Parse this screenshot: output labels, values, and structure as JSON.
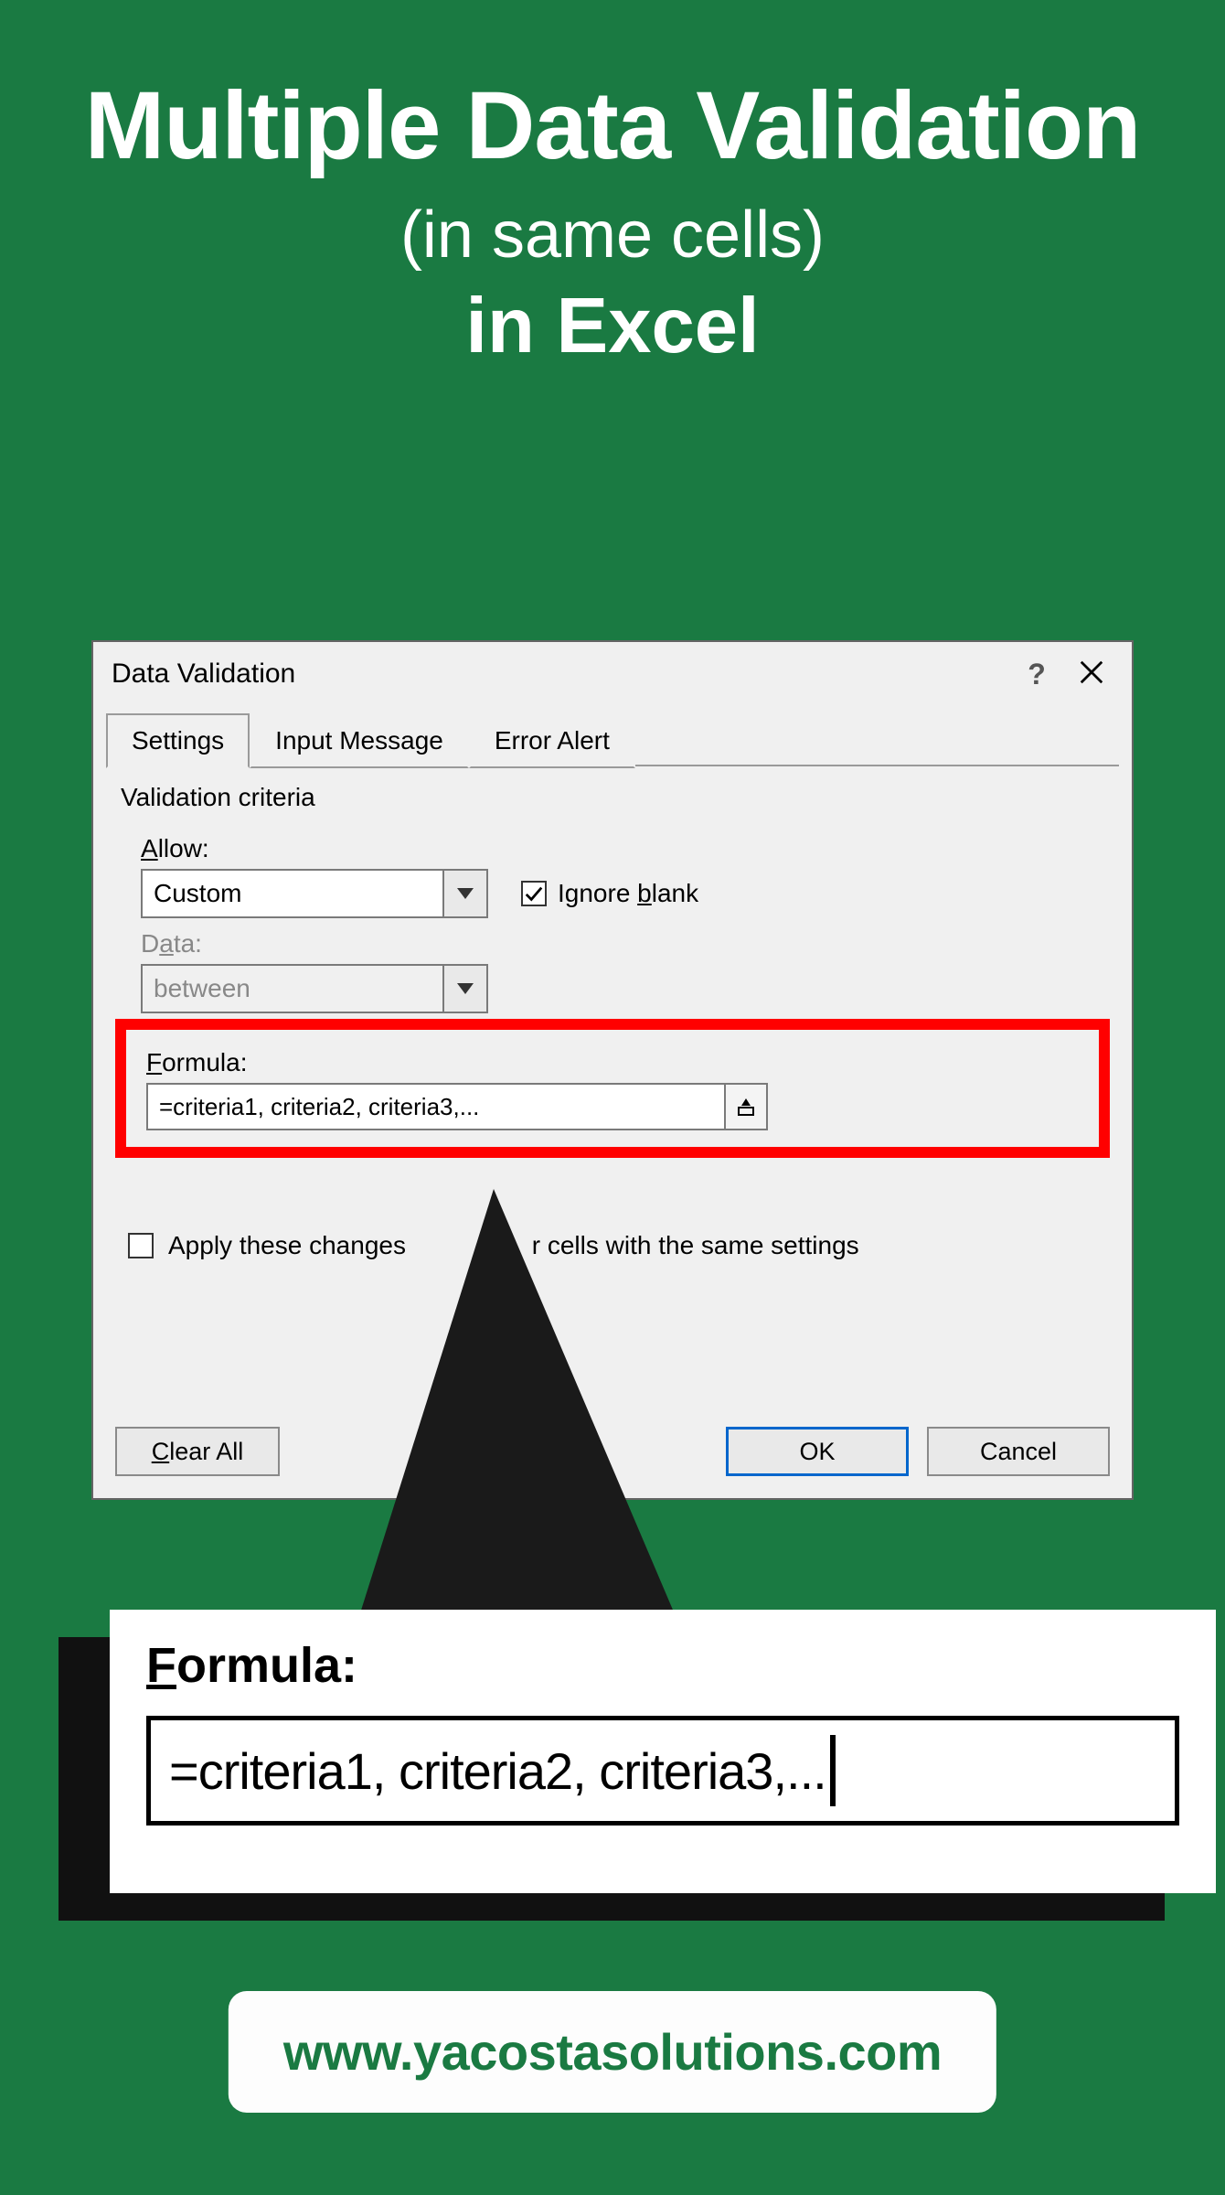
{
  "heading": {
    "line1": "Multiple Data Validation",
    "line2": "(in same cells)",
    "line3": "in Excel"
  },
  "dialog": {
    "title": "Data Validation",
    "tabs": [
      "Settings",
      "Input Message",
      "Error Alert"
    ],
    "section": "Validation criteria",
    "allow_label_pre": "A",
    "allow_label_post": "llow:",
    "allow_value": "Custom",
    "ignore_blank_pre": "Ignore ",
    "ignore_blank_u": "b",
    "ignore_blank_post": "lank",
    "data_label_pre": "D",
    "data_label_u": "a",
    "data_label_post": "ta:",
    "data_value": "between",
    "formula_label_u": "F",
    "formula_label_post": "ormula:",
    "formula_value": "=criteria1, criteria2, criteria3,...",
    "apply_text_pre": "Apply these changes ",
    "apply_text_mid": "r cells with the same settings",
    "clear_u": "C",
    "clear_post": "lear All",
    "ok": "OK",
    "cancel": "Cancel"
  },
  "callout": {
    "label_u": "F",
    "label_post": "ormula:",
    "value": "=criteria1, criteria2, criteria3,..."
  },
  "footer": {
    "url": "www.yacostasolutions.com"
  },
  "icons": {
    "close": "close-icon",
    "help": "help-icon",
    "chevron_down": "chevron-down-icon",
    "ref_picker": "range-picker-icon",
    "check": "check-icon"
  }
}
